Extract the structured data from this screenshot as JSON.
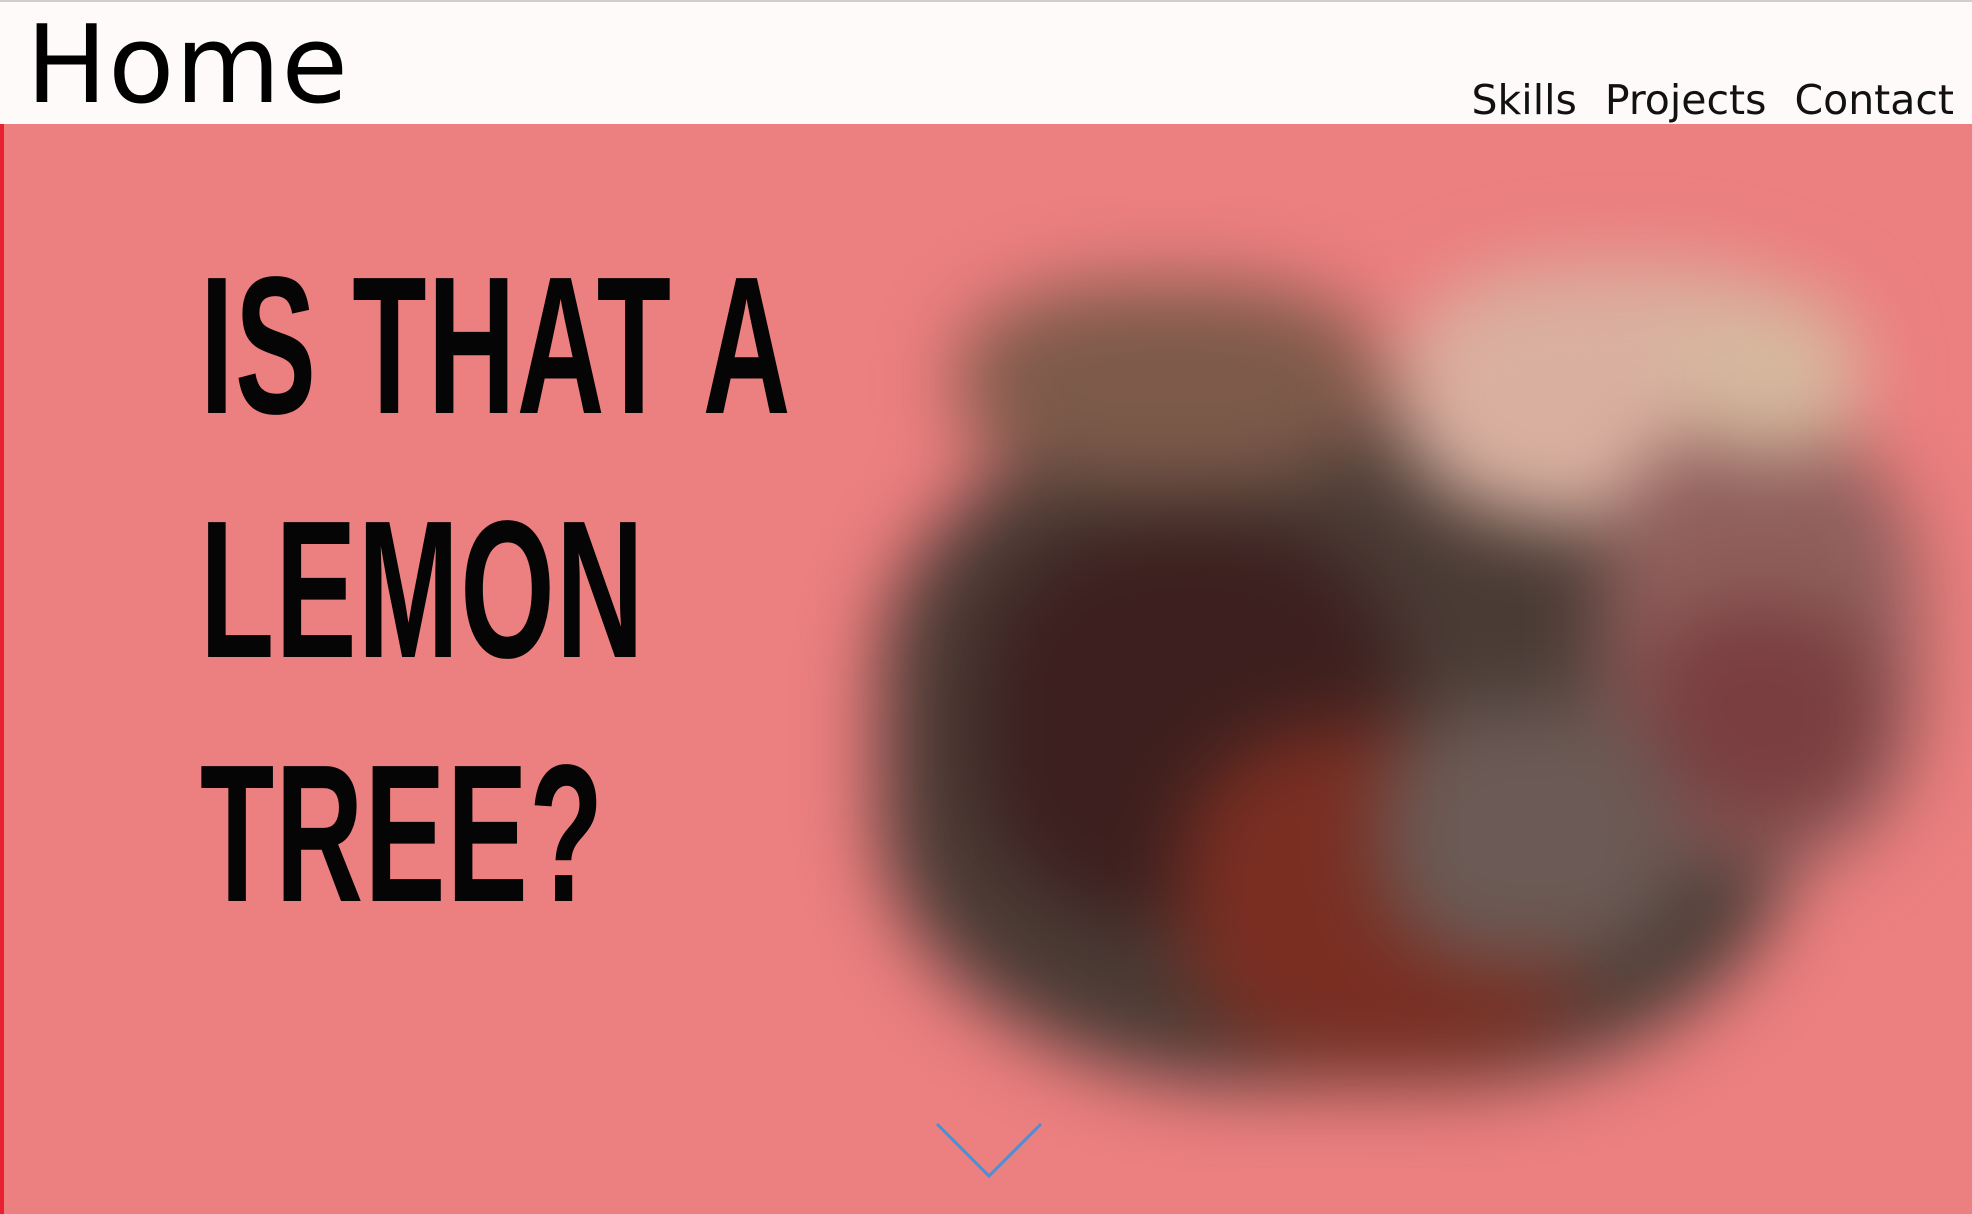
{
  "header": {
    "brand": "Home",
    "nav": [
      "Skills",
      "Projects",
      "Contact"
    ]
  },
  "hero": {
    "headline_lines": [
      "IS THAT A",
      "LEMON",
      "TREE?"
    ],
    "background_color": "#ec7f7f",
    "edge_color": "#e8202f",
    "scroll_icon": "chevron-down-icon",
    "scroll_icon_color": "#4a90d9"
  }
}
